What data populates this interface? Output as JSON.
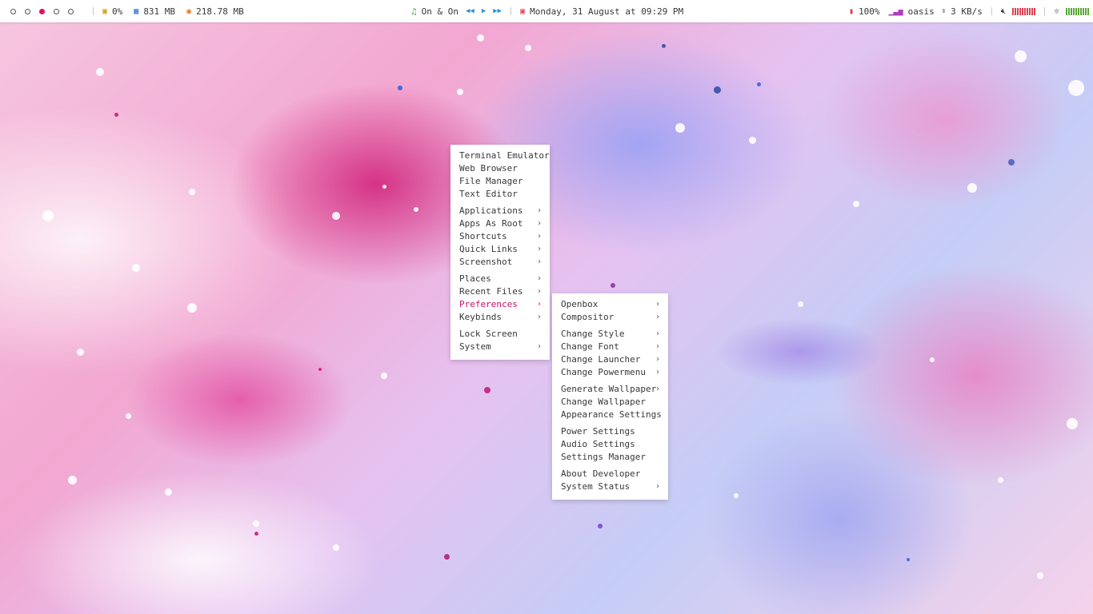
{
  "colors": {
    "accent": "#d10f6a",
    "bar_bg": "#ffffff",
    "text": "#383838"
  },
  "topbar": {
    "workspaces": [
      {
        "active": false
      },
      {
        "active": false
      },
      {
        "active": true
      },
      {
        "active": false
      },
      {
        "active": false
      }
    ],
    "cpu": {
      "icon": "cpu-icon",
      "value": "0%"
    },
    "memory": {
      "icon": "memory-icon",
      "value": "831 MB"
    },
    "disk": {
      "icon": "disk-icon",
      "value": "218.78 MB"
    },
    "music": {
      "icon": "music-note-icon",
      "track": "On & On"
    },
    "calendar": {
      "icon": "calendar-icon",
      "text": "Monday, 31 August at 09:29 PM"
    },
    "battery": {
      "icon": "battery-icon",
      "value": "100%"
    },
    "network": {
      "icon": "wifi-signal-icon",
      "ssid": "oasis",
      "speed": "3 KB/s"
    },
    "volume": {
      "icon": "mute-icon"
    },
    "brightness": {
      "icon": "brightness-icon"
    }
  },
  "root_menu": {
    "groups": [
      [
        {
          "label": "Terminal Emulator",
          "submenu": false
        },
        {
          "label": "Web Browser",
          "submenu": false
        },
        {
          "label": "File Manager",
          "submenu": false
        },
        {
          "label": "Text Editor",
          "submenu": false
        }
      ],
      [
        {
          "label": "Applications",
          "submenu": true
        },
        {
          "label": "Apps As Root",
          "submenu": true
        },
        {
          "label": "Shortcuts",
          "submenu": true
        },
        {
          "label": "Quick Links",
          "submenu": true
        },
        {
          "label": "Screenshot",
          "submenu": true
        }
      ],
      [
        {
          "label": "Places",
          "submenu": true
        },
        {
          "label": "Recent Files",
          "submenu": true
        },
        {
          "label": "Preferences",
          "submenu": true,
          "selected": true
        },
        {
          "label": "Keybinds",
          "submenu": true
        }
      ],
      [
        {
          "label": "Lock Screen",
          "submenu": false
        },
        {
          "label": "System",
          "submenu": true
        }
      ]
    ]
  },
  "preferences_menu": {
    "groups": [
      [
        {
          "label": "Openbox",
          "submenu": true
        },
        {
          "label": "Compositor",
          "submenu": true
        }
      ],
      [
        {
          "label": "Change Style",
          "submenu": true
        },
        {
          "label": "Change Font",
          "submenu": true
        },
        {
          "label": "Change Launcher",
          "submenu": true
        },
        {
          "label": "Change Powermenu",
          "submenu": true
        }
      ],
      [
        {
          "label": "Generate Wallpaper",
          "submenu": true
        },
        {
          "label": "Change Wallpaper",
          "submenu": false
        },
        {
          "label": "Appearance Settings",
          "submenu": false
        }
      ],
      [
        {
          "label": "Power Settings",
          "submenu": false
        },
        {
          "label": "Audio Settings",
          "submenu": false
        },
        {
          "label": "Settings Manager",
          "submenu": false
        }
      ],
      [
        {
          "label": "About Developer",
          "submenu": false
        },
        {
          "label": "System Status",
          "submenu": true
        }
      ]
    ]
  }
}
